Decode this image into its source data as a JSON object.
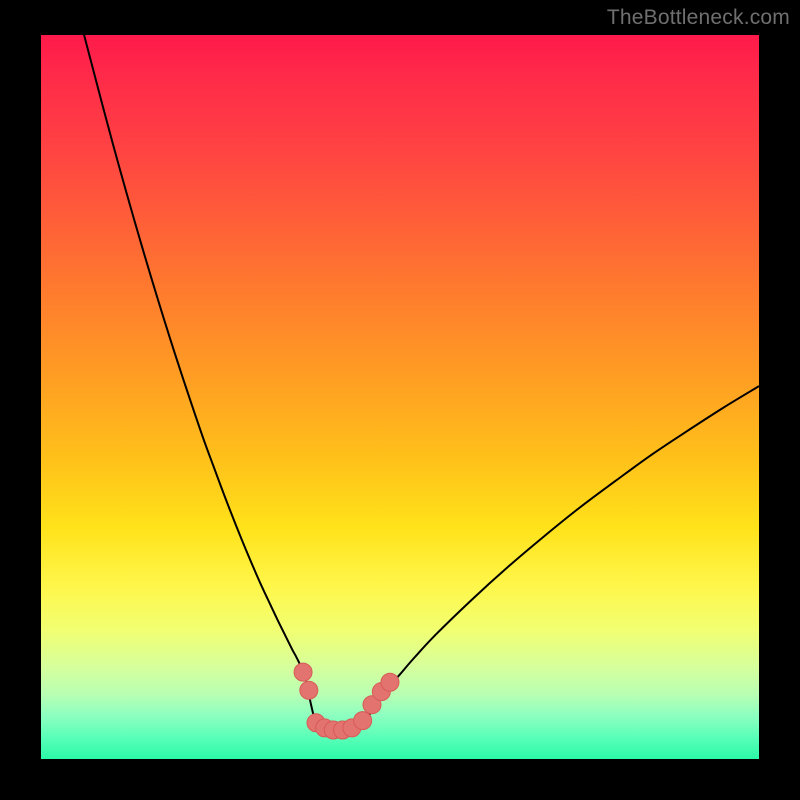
{
  "watermark": "TheBottleneck.com",
  "colors": {
    "curve": "#000000",
    "marker_fill": "#e2736f",
    "marker_stroke": "#d85a57",
    "background_black": "#000000"
  },
  "chart_data": {
    "type": "line",
    "title": "",
    "xlabel": "",
    "ylabel": "",
    "xlim": [
      0,
      100
    ],
    "ylim": [
      0,
      100
    ],
    "series": [
      {
        "name": "left-curve",
        "x": [
          6,
          10,
          14,
          18,
          22,
          24,
          26,
          28,
          30,
          31,
          32,
          33,
          34,
          34.5,
          35,
          35.5,
          36,
          36.5,
          37,
          37.5,
          38,
          38.5
        ],
        "values": [
          100,
          85,
          71,
          58,
          46,
          40.5,
          35.2,
          30.2,
          25.5,
          23.3,
          21.2,
          19.1,
          17.1,
          16.1,
          15.1,
          14.2,
          13.2,
          12.0,
          10.5,
          8.0,
          5.9,
          4.3
        ]
      },
      {
        "name": "flat-bottom",
        "x": [
          38.5,
          39.5,
          40.5,
          41.5,
          42.5,
          43.5,
          44.2
        ],
        "values": [
          4.3,
          4.0,
          3.85,
          3.8,
          3.85,
          4.0,
          4.3
        ]
      },
      {
        "name": "right-curve",
        "x": [
          44.2,
          45,
          46,
          47,
          48,
          49,
          50,
          52,
          55,
          60,
          65,
          70,
          75,
          80,
          85,
          90,
          95,
          100
        ],
        "values": [
          4.3,
          5.2,
          6.5,
          8.0,
          9.5,
          10.6,
          11.7,
          14.0,
          17.2,
          22.0,
          26.5,
          30.7,
          34.7,
          38.4,
          42.0,
          45.3,
          48.5,
          51.5
        ]
      }
    ],
    "markers": [
      {
        "x": 36.5,
        "y": 12.0
      },
      {
        "x": 37.3,
        "y": 9.5
      },
      {
        "x": 38.3,
        "y": 5.0
      },
      {
        "x": 39.5,
        "y": 4.3
      },
      {
        "x": 40.7,
        "y": 4.0
      },
      {
        "x": 42.0,
        "y": 4.0
      },
      {
        "x": 43.3,
        "y": 4.3
      },
      {
        "x": 44.8,
        "y": 5.3
      },
      {
        "x": 46.1,
        "y": 7.5
      },
      {
        "x": 47.4,
        "y": 9.3
      },
      {
        "x": 48.6,
        "y": 10.6
      }
    ],
    "marker_radius_px": 9
  }
}
